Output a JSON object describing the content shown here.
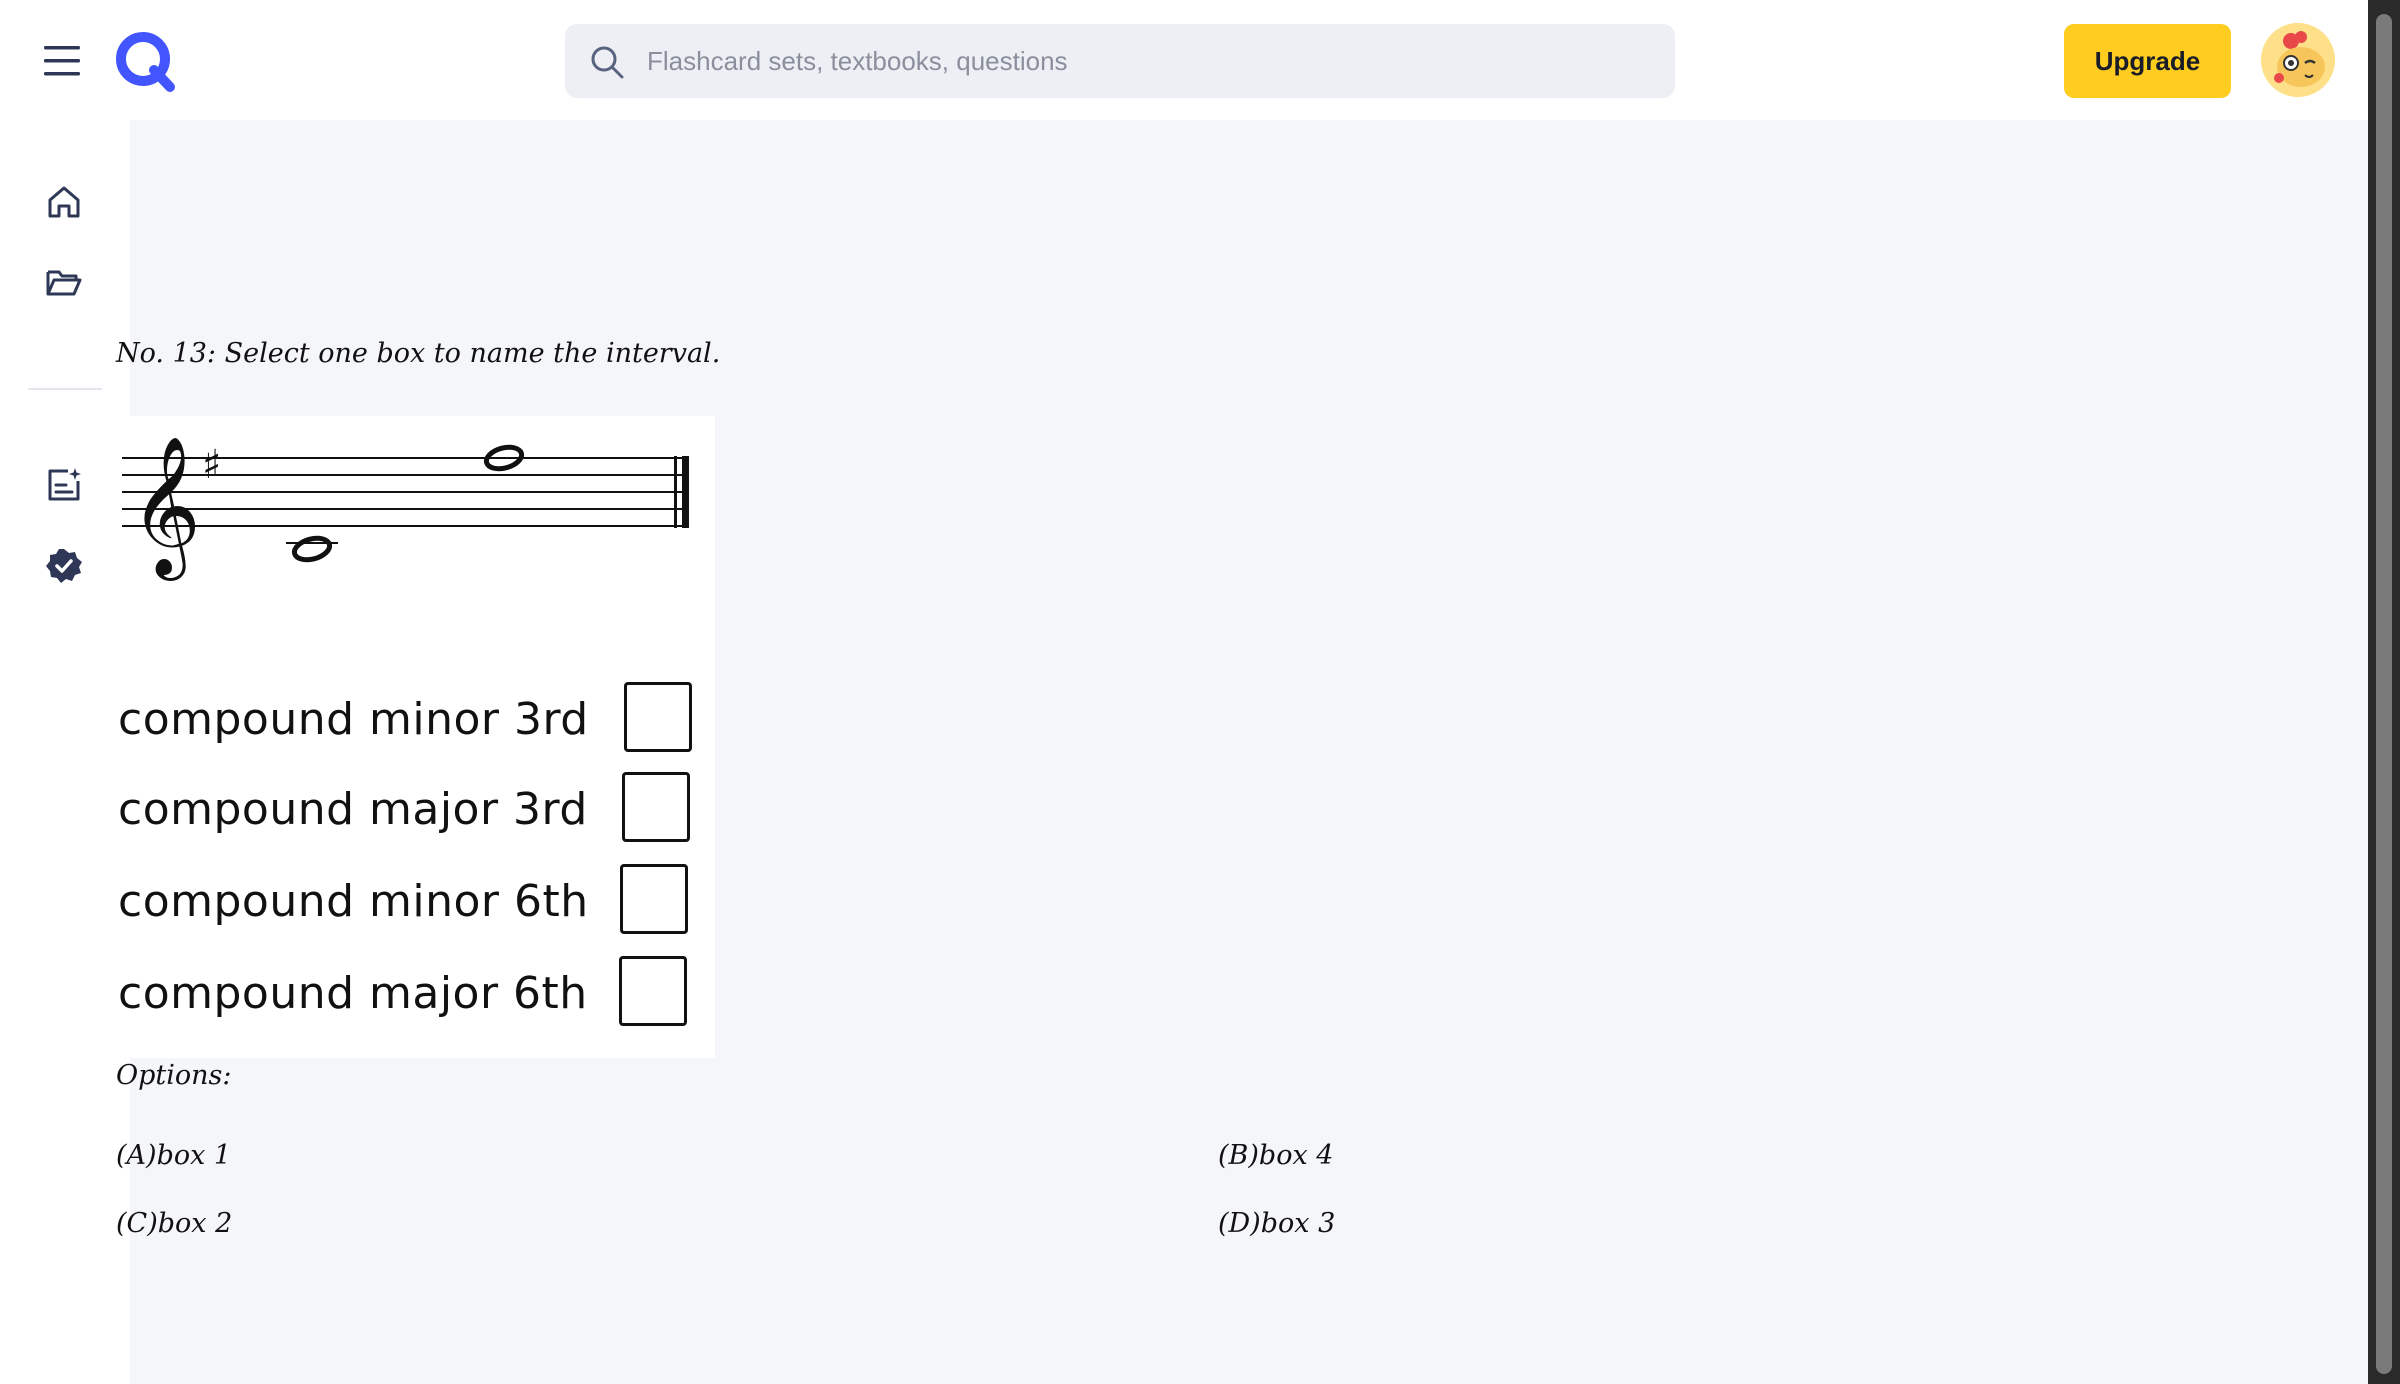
{
  "header": {
    "menu_icon": "hamburger-menu-icon",
    "logo_icon": "quizlet-q-logo",
    "search": {
      "placeholder": "Flashcard sets, textbooks, questions",
      "value": "",
      "icon": "search-icon"
    },
    "upgrade_label": "Upgrade",
    "avatar_icon": "user-avatar"
  },
  "sidebar": {
    "items": [
      {
        "name": "home",
        "icon": "home-icon"
      },
      {
        "name": "library",
        "icon": "folder-open-icon"
      },
      {
        "name": "create",
        "icon": "add-document-icon"
      },
      {
        "name": "verified",
        "icon": "verified-badge-icon"
      }
    ]
  },
  "question": {
    "text": "No. 13:  Select one box to name the interval.",
    "choices": [
      "compound minor 3rd",
      "compound major 3rd",
      "compound minor 6th",
      "compound major 6th"
    ]
  },
  "options": {
    "title": "Options:",
    "items": [
      {
        "id": "A",
        "label": "(A)box 1"
      },
      {
        "id": "B",
        "label": "(B)box 4"
      },
      {
        "id": "C",
        "label": "(C)box 2"
      },
      {
        "id": "D",
        "label": "(D)box 3"
      }
    ]
  },
  "colors": {
    "accent": "#4255ff",
    "upgrade_bg": "#ffcd1f",
    "content_bg": "#f5f6fa",
    "search_bg": "#edeff4"
  }
}
